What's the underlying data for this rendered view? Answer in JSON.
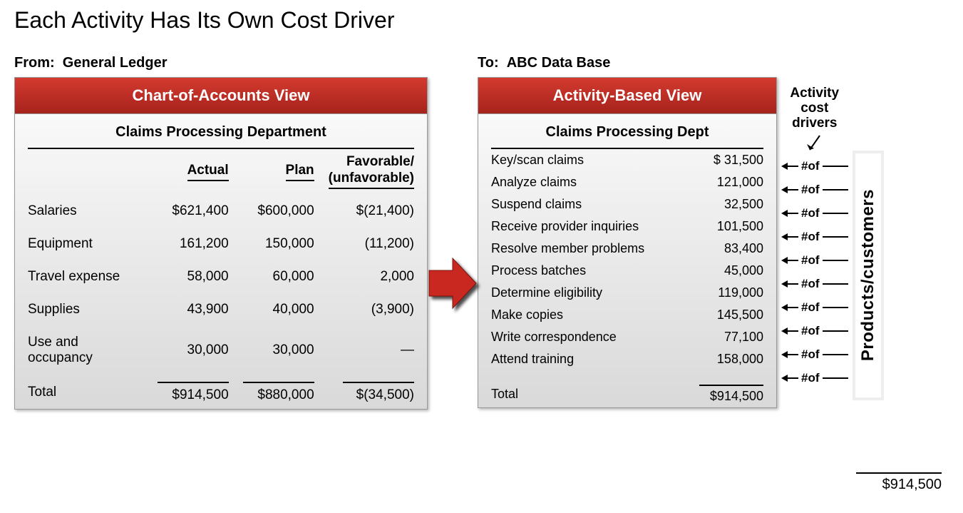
{
  "title": "Each Activity Has Its Own Cost Driver",
  "from_prefix": "From:",
  "from_label": "General Ledger",
  "to_prefix": "To:",
  "to_label": "ABC Data Base",
  "left": {
    "header": "Chart-of-Accounts View",
    "sub": "Claims Processing Department",
    "col_actual": "Actual",
    "col_plan": "Plan",
    "col_fav_line1": "Favorable/",
    "col_fav_line2": "(unfavorable)",
    "rows": [
      {
        "label": "Salaries",
        "actual": "$621,400",
        "plan": "$600,000",
        "fav": "$(21,400)"
      },
      {
        "label": "Equipment",
        "actual": "161,200",
        "plan": "150,000",
        "fav": "(11,200)"
      },
      {
        "label": "Travel expense",
        "actual": "58,000",
        "plan": "60,000",
        "fav": "2,000"
      },
      {
        "label": "Supplies",
        "actual": "43,900",
        "plan": "40,000",
        "fav": "(3,900)"
      },
      {
        "label": "Use and occupancy",
        "actual": "30,000",
        "plan": "30,000",
        "fav": "—"
      }
    ],
    "total_label": "Total",
    "total_actual": "$914,500",
    "total_plan": "$880,000",
    "total_fav": "$(34,500)"
  },
  "right": {
    "header": "Activity-Based View",
    "sub": "Claims Processing Dept",
    "rows": [
      {
        "label": "Key/scan claims",
        "value": "$  31,500"
      },
      {
        "label": "Analyze claims",
        "value": "121,000"
      },
      {
        "label": "Suspend claims",
        "value": "32,500"
      },
      {
        "label": "Receive provider inquiries",
        "value": "101,500"
      },
      {
        "label": "Resolve member problems",
        "value": "83,400"
      },
      {
        "label": "Process batches",
        "value": "45,000"
      },
      {
        "label": "Determine eligibility",
        "value": "119,000"
      },
      {
        "label": "Make copies",
        "value": "145,500"
      },
      {
        "label": "Write correspondence",
        "value": "77,100"
      },
      {
        "label": "Attend training",
        "value": "158,000"
      }
    ],
    "total_label": "Total",
    "total_value": "$914,500"
  },
  "anno": {
    "title_l1": "Activity",
    "title_l2": "cost",
    "title_l3": "drivers",
    "numof": "#of"
  },
  "pc_label": "Products/customers",
  "pc_total": "$914,500",
  "chart_data": {
    "type": "table",
    "general_ledger": {
      "department": "Claims Processing Department",
      "columns": [
        "Actual",
        "Plan",
        "Favorable/(unfavorable)"
      ],
      "rows": [
        [
          "Salaries",
          621400,
          600000,
          -21400
        ],
        [
          "Equipment",
          161200,
          150000,
          -11200
        ],
        [
          "Travel expense",
          58000,
          60000,
          2000
        ],
        [
          "Supplies",
          43900,
          40000,
          -3900
        ],
        [
          "Use and occupancy",
          30000,
          30000,
          0
        ]
      ],
      "totals": [
        914500,
        880000,
        -34500
      ]
    },
    "abc": {
      "department": "Claims Processing Dept",
      "rows": [
        [
          "Key/scan claims",
          31500
        ],
        [
          "Analyze claims",
          121000
        ],
        [
          "Suspend claims",
          32500
        ],
        [
          "Receive provider inquiries",
          101500
        ],
        [
          "Resolve member problems",
          83400
        ],
        [
          "Process batches",
          45000
        ],
        [
          "Determine eligibility",
          119000
        ],
        [
          "Make copies",
          145500
        ],
        [
          "Write correspondence",
          77100
        ],
        [
          "Attend training",
          158000
        ]
      ],
      "total": 914500
    },
    "products_customers_total": 914500
  }
}
